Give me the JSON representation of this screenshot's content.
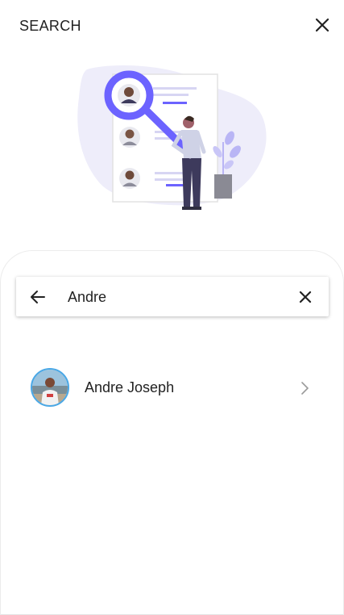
{
  "header": {
    "title": "SEARCH",
    "close_icon": "close-icon"
  },
  "search": {
    "value": "Andre",
    "back_icon": "arrow-left-icon",
    "clear_icon": "close-icon"
  },
  "results": [
    {
      "name": "Andre Joseph",
      "avatar_icon": "avatar-photo",
      "chevron_icon": "chevron-right-icon"
    }
  ],
  "colors": {
    "accent": "#6c63ff",
    "avatar_ring": "#4aa8e6",
    "text": "#222222"
  }
}
